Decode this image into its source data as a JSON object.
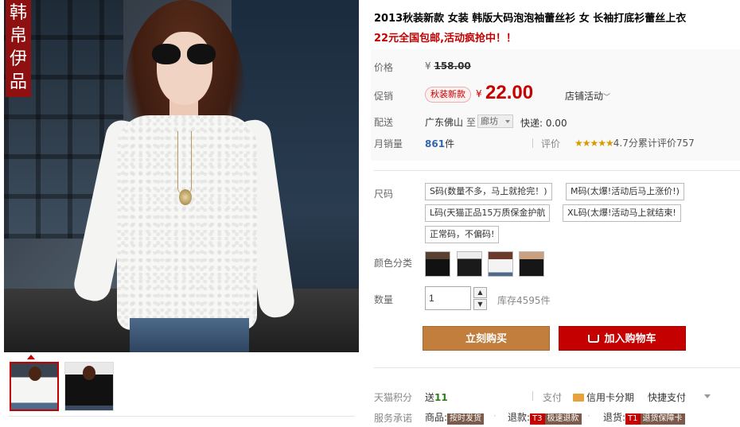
{
  "brand_stamp": {
    "chars": [
      "韩",
      "帛",
      "伊",
      "品"
    ]
  },
  "product": {
    "title": "2013秋装新款 女装 韩版大码泡泡袖蕾丝衫 女 长袖打底衫蕾丝上衣",
    "subtitle": "22元全国包邮,活动疯抢中！！"
  },
  "price": {
    "label": "价格",
    "currency": "¥",
    "original": "158.00"
  },
  "promo": {
    "label": "促销",
    "badge": "秋装新款",
    "currency": "¥",
    "price": "22.00",
    "store_activity": "店铺活动"
  },
  "shipping": {
    "label": "配送",
    "from": "广东佛山",
    "to_word": "至",
    "destination": "廊坊",
    "express": "快递: 0.00"
  },
  "sales": {
    "label": "月销量",
    "count": "861",
    "unit": "件",
    "rating_label": "评价",
    "stars": "★★★★★",
    "rating_text": "4.7分累计评价757"
  },
  "size": {
    "label": "尺码",
    "options": [
      "S码(数量不多，马上就抢完！)",
      "M码(太爆!活动后马上涨价!)",
      "L码(天猫正品15万质保金护航",
      "XL码(太爆!活动马上就结束!",
      "正常码，不偏码!"
    ]
  },
  "color": {
    "label": "颜色分类"
  },
  "quantity": {
    "label": "数量",
    "value": "1",
    "up": "▲",
    "down": "▼",
    "stock": "库存4595件"
  },
  "actions": {
    "buy_now": "立刻购买",
    "add_to_cart": "加入购物车"
  },
  "points": {
    "label": "天猫积分",
    "value_prefix": "送",
    "value": "11",
    "payment_label": "支付",
    "credit_installment": "信用卡分期",
    "fast_pay": "快捷支付"
  },
  "service": {
    "label": "服务承诺",
    "goods_label": "商品:",
    "goods_tag": "按时发货",
    "refund_label": "退款:",
    "refund_tag_code": "T3",
    "refund_tag": "极速退款",
    "return_label": "退货:",
    "return_tag_code": "T1",
    "return_tag": "退货保障卡"
  }
}
